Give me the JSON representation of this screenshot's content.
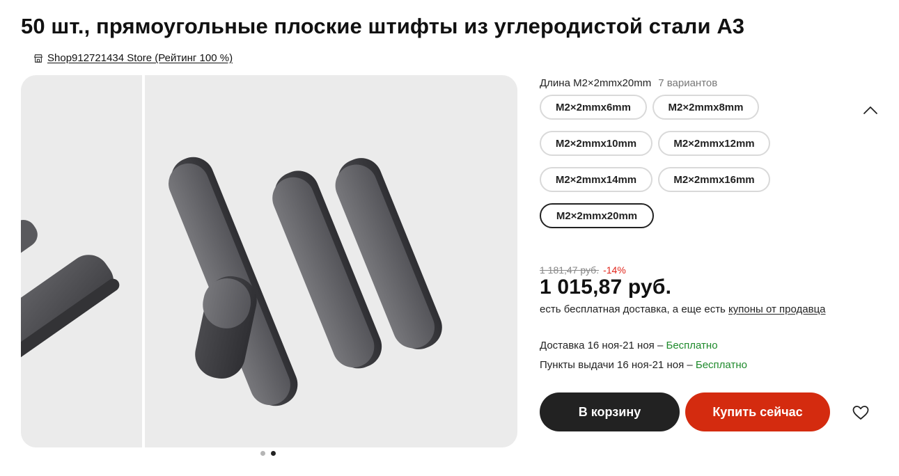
{
  "product": {
    "title": "50 шт., прямоугольные плоские штифты из углеродистой стали A3",
    "store_link": "Shop912721434 Store (Рейтинг 100 %)"
  },
  "gallery": {
    "slide_count": 2,
    "active_slide": 2
  },
  "variants": {
    "label": "Длина M2×2mmx20mm",
    "count_text": "7 вариантов",
    "options": [
      "M2×2mmx6mm",
      "M2×2mmx8mm",
      "M2×2mmx10mm",
      "M2×2mmx12mm",
      "M2×2mmx14mm",
      "M2×2mmx16mm",
      "M2×2mmx20mm"
    ],
    "selected": "M2×2mmx20mm"
  },
  "pricing": {
    "old_price": "1 181,47 руб.",
    "discount": "-14%",
    "price": "1 015,87 руб.",
    "shipping_note": "есть бесплатная доставка, а еще есть ",
    "coupons_link": "купоны от продавца"
  },
  "delivery": {
    "courier_text": "Доставка 16 ноя-21 ноя – ",
    "courier_cost": "Бесплатно",
    "pickup_text": "Пункты выдачи 16 ноя-21 ноя – ",
    "pickup_cost": "Бесплатно"
  },
  "actions": {
    "cart_label": "В корзину",
    "buy_label": "Купить сейчас"
  },
  "colors": {
    "accent_red": "#d42b0f",
    "dark_button": "#222222",
    "free_green": "#1e8a2b",
    "discount_red": "#e1251b"
  },
  "icons": [
    "store-icon",
    "chevron-up-icon",
    "heart-icon"
  ]
}
